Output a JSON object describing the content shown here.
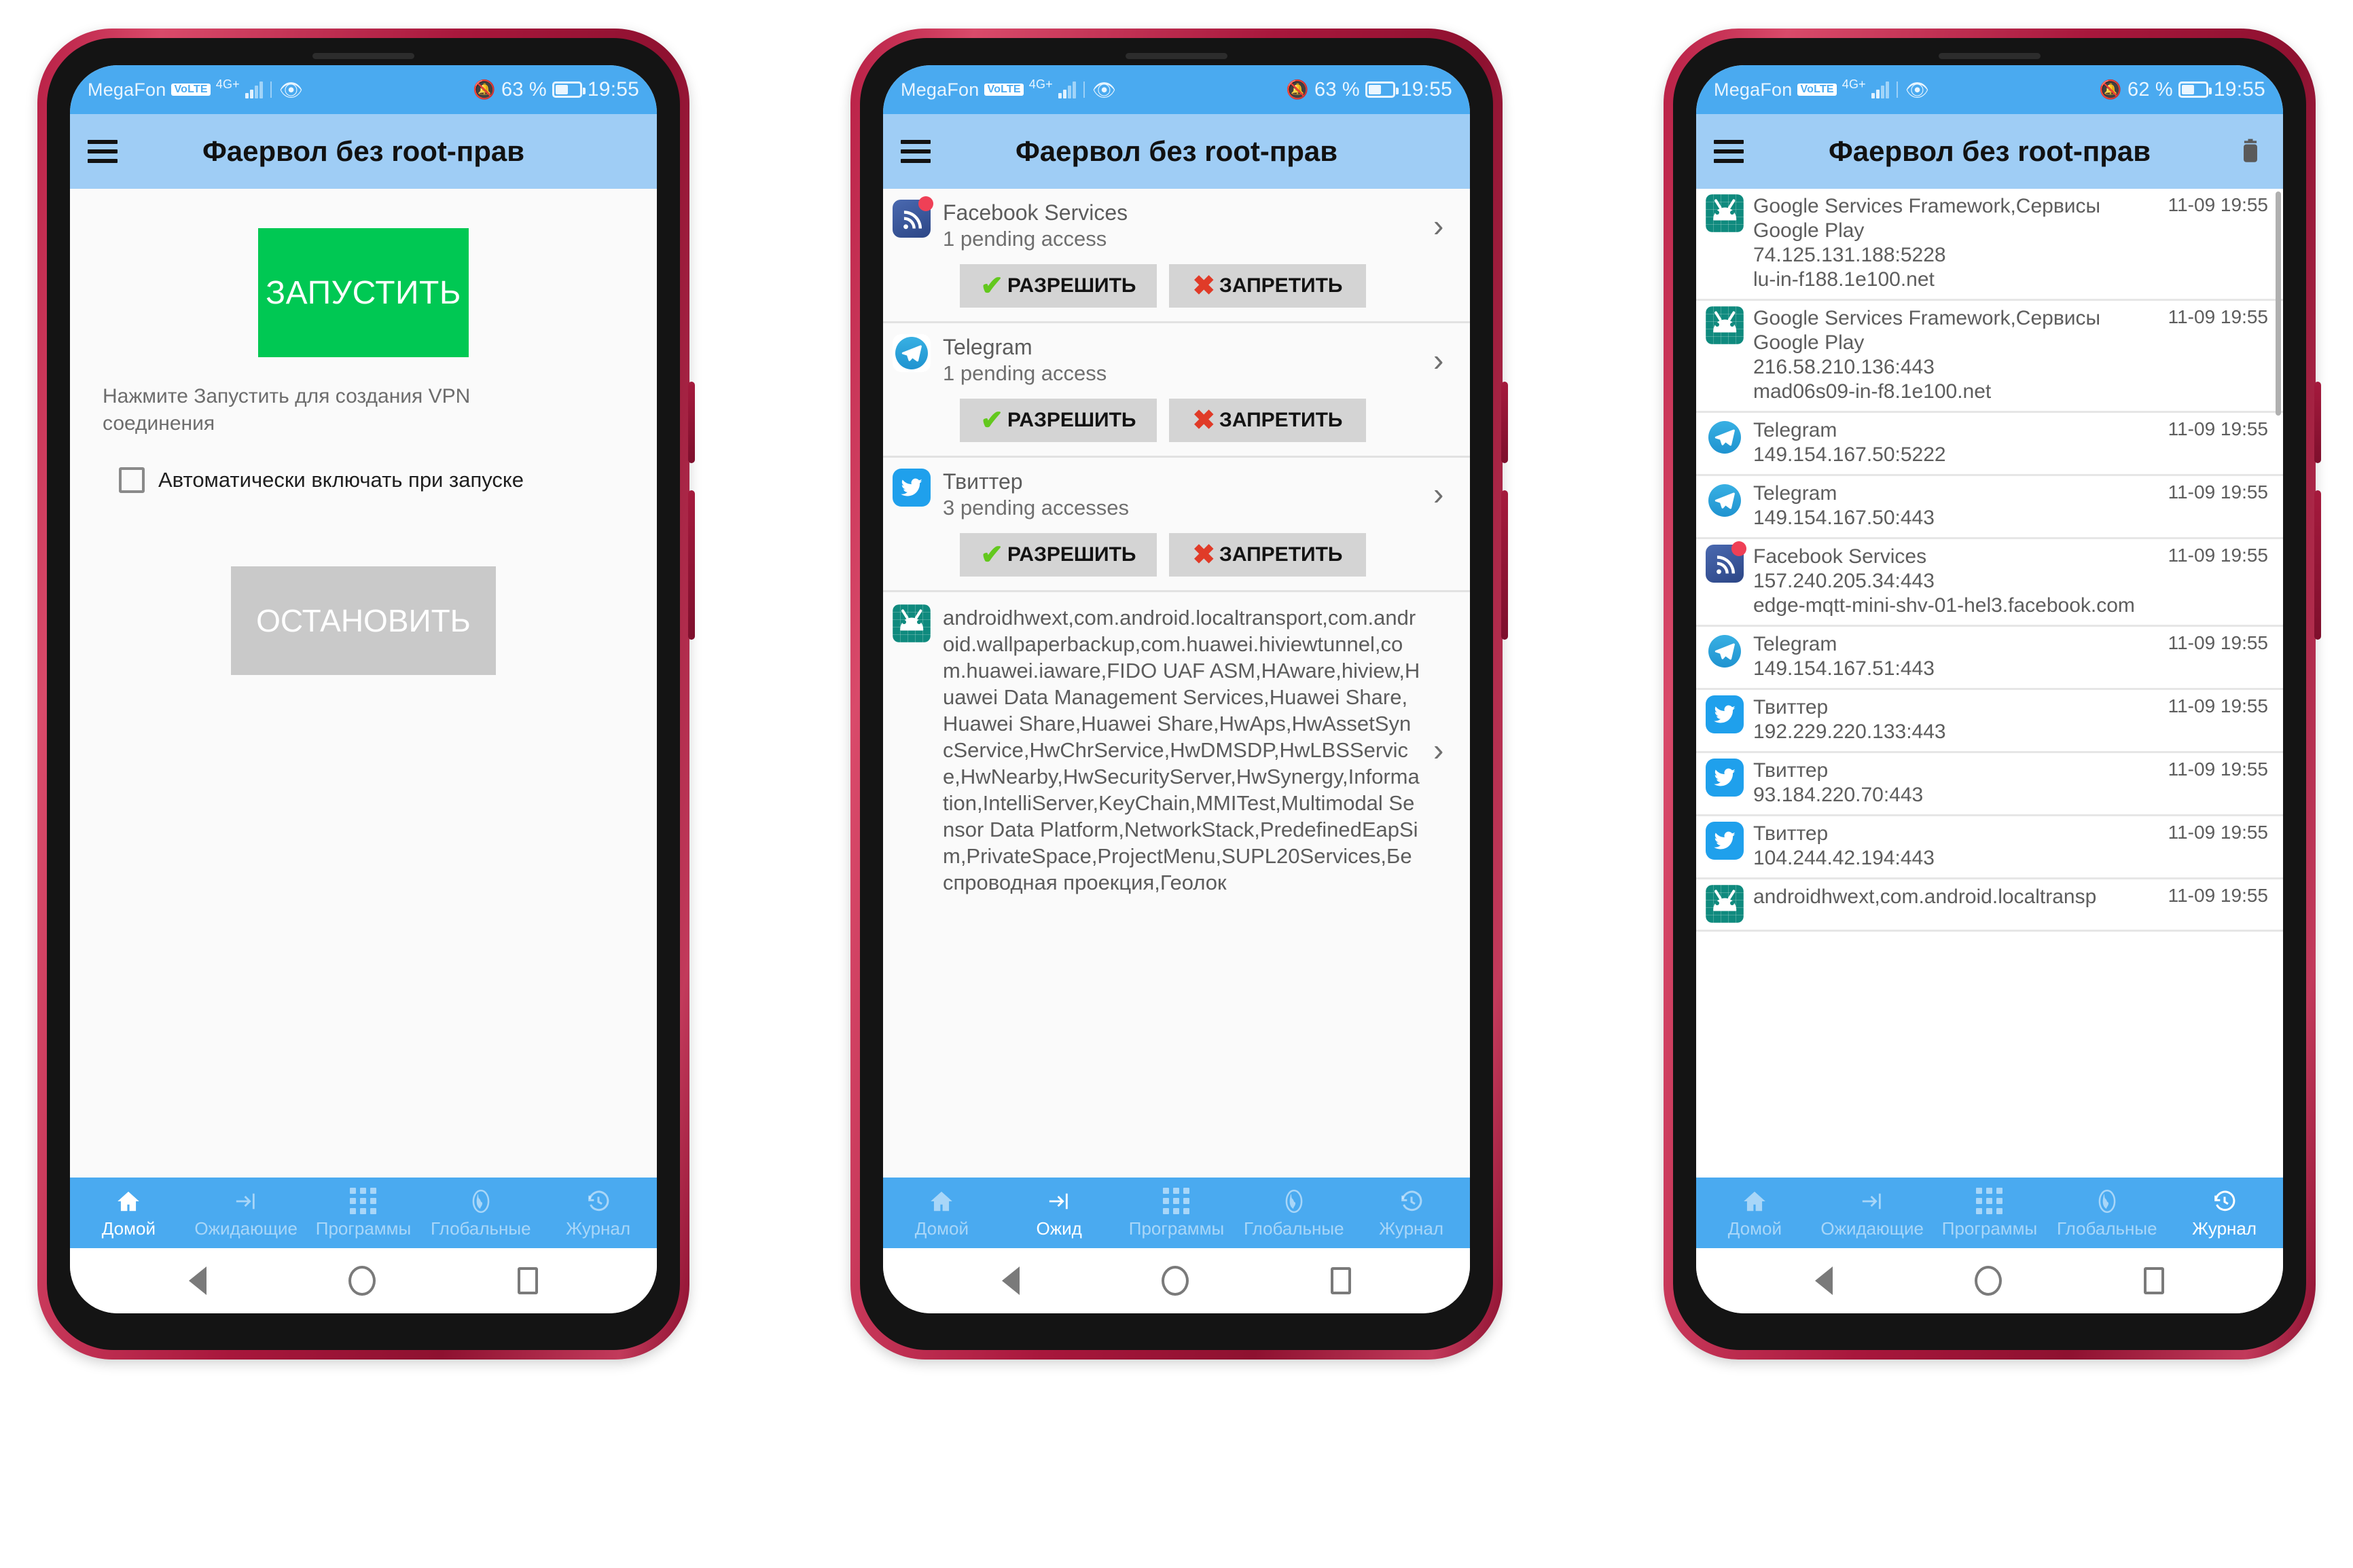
{
  "status_bar": {
    "carrier": "MegaFon",
    "volte": "VoLTE",
    "network": "4G+",
    "battery_1": "63 %",
    "battery_2": "63 %",
    "battery_3": "62 %",
    "clock": "19:55"
  },
  "app": {
    "title": "Фаервол без root-прав"
  },
  "home": {
    "start_label": "ЗАПУСТИТЬ",
    "hint": "Нажмите Запустить для создания VPN соединения",
    "autostart_label": "Автоматически включать при запуске",
    "stop_label": "ОСТАНОВИТЬ"
  },
  "pending": {
    "allow_label": "РАЗРЕШИТЬ",
    "deny_label": "ЗАПРЕТИТЬ",
    "items": [
      {
        "icon": "facebook-services-icon",
        "name": "Facebook Services",
        "sub": "1 pending access"
      },
      {
        "icon": "telegram-icon",
        "name": "Telegram",
        "sub": "1 pending access"
      },
      {
        "icon": "twitter-icon",
        "name": "Твиттер",
        "sub": "3 pending accesses"
      }
    ],
    "long_entry": {
      "icon": "android-system-icon",
      "text": "androidhwext,com.android.localtransport,com.android.wallpaperbackup,com.huawei.hiviewtunnel,com.huawei.iaware,FIDO UAF ASM,HAware,hiview,Huawei Data Management Services,Huawei Share,Huawei Share,Huawei Share,HwAps,HwAssetSyncService,HwChrService,HwDMSDP,HwLBSService,HwNearby,HwSecurityServer,HwSynergy,Information,IntelliServer,KeyChain,MMITest,Multimodal Sensor Data Platform,NetworkStack,PredefinedEapSim,PrivateSpace,ProjectMenu,SUPL20Services,Беспроводная проекция,Геолок"
    }
  },
  "log": {
    "items": [
      {
        "icon": "android-system-icon",
        "title": "Google Services Framework,Сервисы Google Play",
        "time": "11-09 19:55",
        "address": "74.125.131.188:5228",
        "host": "lu-in-f188.1e100.net"
      },
      {
        "icon": "android-system-icon",
        "title": "Google Services Framework,Сервисы Google Play",
        "time": "11-09 19:55",
        "address": "216.58.210.136:443",
        "host": "mad06s09-in-f8.1e100.net"
      },
      {
        "icon": "telegram-icon",
        "title": "Telegram",
        "time": "11-09 19:55",
        "address": "149.154.167.50:5222",
        "host": ""
      },
      {
        "icon": "telegram-icon",
        "title": "Telegram",
        "time": "11-09 19:55",
        "address": "149.154.167.50:443",
        "host": ""
      },
      {
        "icon": "facebook-services-icon",
        "title": "Facebook Services",
        "time": "11-09 19:55",
        "address": "157.240.205.34:443",
        "host": "edge-mqtt-mini-shv-01-hel3.facebook.com"
      },
      {
        "icon": "telegram-icon",
        "title": "Telegram",
        "time": "11-09 19:55",
        "address": "149.154.167.51:443",
        "host": ""
      },
      {
        "icon": "twitter-icon",
        "title": "Твиттер",
        "time": "11-09 19:55",
        "address": "192.229.220.133:443",
        "host": ""
      },
      {
        "icon": "twitter-icon",
        "title": "Твиттер",
        "time": "11-09 19:55",
        "address": "93.184.220.70:443",
        "host": ""
      },
      {
        "icon": "twitter-icon",
        "title": "Твиттер",
        "time": "11-09 19:55",
        "address": "104.244.42.194:443",
        "host": ""
      },
      {
        "icon": "android-system-icon",
        "title": "androidhwext,com.android.localtransp",
        "time": "11-09 19:55",
        "address": "",
        "host": ""
      }
    ]
  },
  "bottom_nav": {
    "home": "Домой",
    "pending_full": "Ожидающие",
    "pending_short": "Ожид",
    "apps": "Программы",
    "global": "Глобальные",
    "log": "Журнал"
  },
  "colors": {
    "status_bar": "#4aaaf0",
    "app_bar": "#9fcdf5",
    "accent": "#4aaaf0",
    "start_green": "#00c853",
    "stop_gray": "#c9c9c9",
    "allow_green": "#63c81e",
    "deny_red": "#e03b28",
    "phone_frame": "#a8173c"
  }
}
